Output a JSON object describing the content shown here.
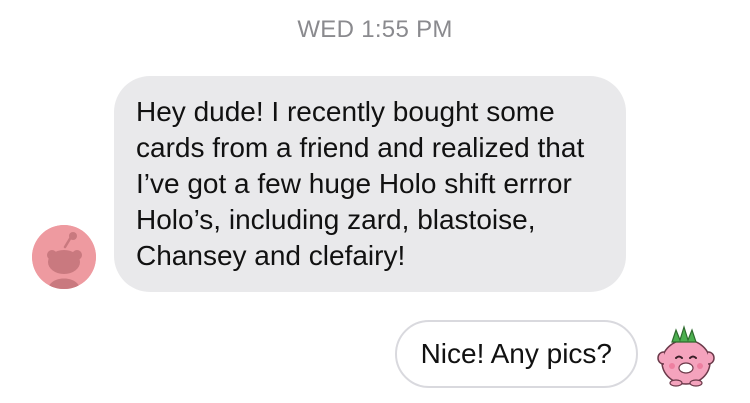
{
  "conversation": {
    "timestamp": "WED 1:55 PM",
    "messages": [
      {
        "direction": "incoming",
        "text": "Hey dude! I recently bought some cards from a friend and realized that I’ve got a few huge Holo shift errror Holo’s, including zard, blastoise, Chansey and clefairy!",
        "avatar_icon": "reddit-alien-avatar-icon"
      },
      {
        "direction": "outgoing",
        "text": "Nice! Any pics?",
        "avatar_icon": "pink-monster-crown-avatar-icon"
      }
    ]
  },
  "colors": {
    "incoming_bubble": "#e9e9eb",
    "outgoing_border": "#d9d9de",
    "timestamp_text": "#8a8a8e",
    "left_avatar_bg": "#ee9aa0"
  }
}
